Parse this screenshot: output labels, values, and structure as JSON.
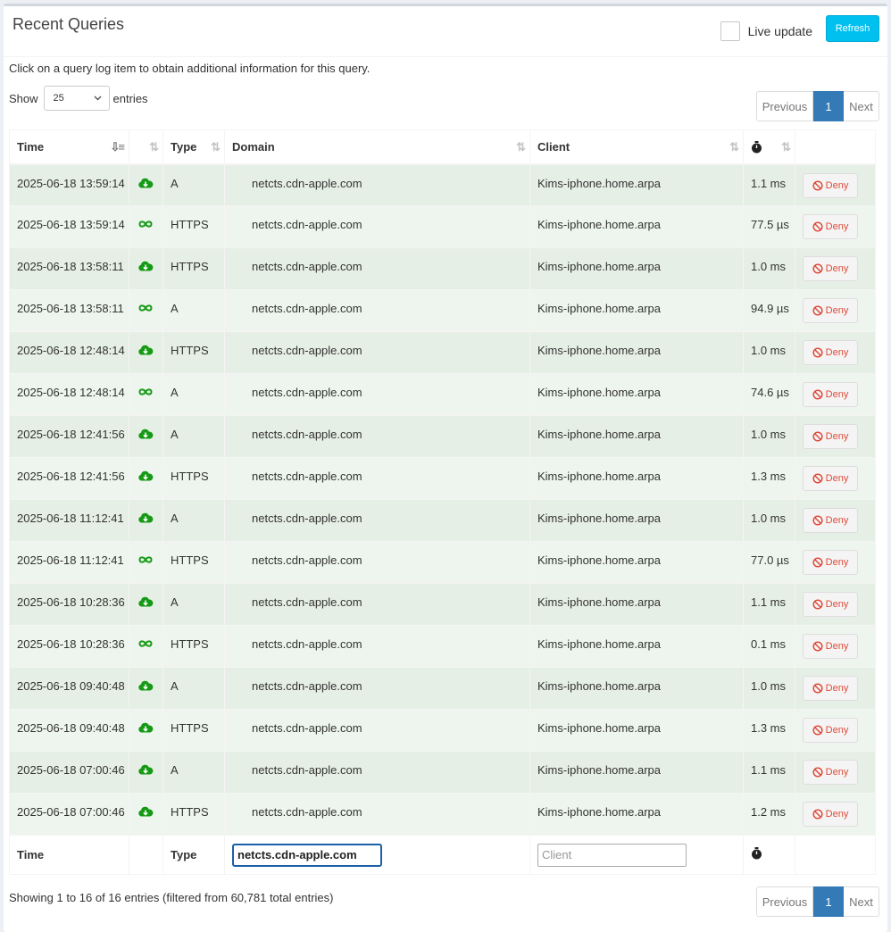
{
  "header": {
    "title": "Recent Queries",
    "live_update_label": "Live update",
    "refresh_label": "Refresh"
  },
  "hint": "Click on a query log item to obtain additional information for this query.",
  "length_control": {
    "show_label": "Show",
    "value": "25",
    "entries_label": "entries"
  },
  "pagination": {
    "previous": "Previous",
    "current": "1",
    "next": "Next"
  },
  "columns": {
    "time": "Time",
    "type": "Type",
    "domain": "Domain",
    "client": "Client"
  },
  "rows": [
    {
      "time": "2025-06-18 13:59:14",
      "status": "forwarded",
      "type": "A",
      "domain": "netcts.cdn-apple.com",
      "client": "Kims-iphone.home.arpa",
      "reply_time": "1.1 ms",
      "action": "Deny"
    },
    {
      "time": "2025-06-18 13:59:14",
      "status": "cached",
      "type": "HTTPS",
      "domain": "netcts.cdn-apple.com",
      "client": "Kims-iphone.home.arpa",
      "reply_time": "77.5 µs",
      "action": "Deny"
    },
    {
      "time": "2025-06-18 13:58:11",
      "status": "forwarded",
      "type": "HTTPS",
      "domain": "netcts.cdn-apple.com",
      "client": "Kims-iphone.home.arpa",
      "reply_time": "1.0 ms",
      "action": "Deny"
    },
    {
      "time": "2025-06-18 13:58:11",
      "status": "cached",
      "type": "A",
      "domain": "netcts.cdn-apple.com",
      "client": "Kims-iphone.home.arpa",
      "reply_time": "94.9 µs",
      "action": "Deny"
    },
    {
      "time": "2025-06-18 12:48:14",
      "status": "forwarded",
      "type": "HTTPS",
      "domain": "netcts.cdn-apple.com",
      "client": "Kims-iphone.home.arpa",
      "reply_time": "1.0 ms",
      "action": "Deny"
    },
    {
      "time": "2025-06-18 12:48:14",
      "status": "cached",
      "type": "A",
      "domain": "netcts.cdn-apple.com",
      "client": "Kims-iphone.home.arpa",
      "reply_time": "74.6 µs",
      "action": "Deny"
    },
    {
      "time": "2025-06-18 12:41:56",
      "status": "forwarded",
      "type": "A",
      "domain": "netcts.cdn-apple.com",
      "client": "Kims-iphone.home.arpa",
      "reply_time": "1.0 ms",
      "action": "Deny"
    },
    {
      "time": "2025-06-18 12:41:56",
      "status": "forwarded",
      "type": "HTTPS",
      "domain": "netcts.cdn-apple.com",
      "client": "Kims-iphone.home.arpa",
      "reply_time": "1.3 ms",
      "action": "Deny"
    },
    {
      "time": "2025-06-18 11:12:41",
      "status": "forwarded",
      "type": "A",
      "domain": "netcts.cdn-apple.com",
      "client": "Kims-iphone.home.arpa",
      "reply_time": "1.0 ms",
      "action": "Deny"
    },
    {
      "time": "2025-06-18 11:12:41",
      "status": "cached",
      "type": "HTTPS",
      "domain": "netcts.cdn-apple.com",
      "client": "Kims-iphone.home.arpa",
      "reply_time": "77.0 µs",
      "action": "Deny"
    },
    {
      "time": "2025-06-18 10:28:36",
      "status": "forwarded",
      "type": "A",
      "domain": "netcts.cdn-apple.com",
      "client": "Kims-iphone.home.arpa",
      "reply_time": "1.1 ms",
      "action": "Deny"
    },
    {
      "time": "2025-06-18 10:28:36",
      "status": "cached",
      "type": "HTTPS",
      "domain": "netcts.cdn-apple.com",
      "client": "Kims-iphone.home.arpa",
      "reply_time": "0.1 ms",
      "action": "Deny"
    },
    {
      "time": "2025-06-18 09:40:48",
      "status": "forwarded",
      "type": "A",
      "domain": "netcts.cdn-apple.com",
      "client": "Kims-iphone.home.arpa",
      "reply_time": "1.0 ms",
      "action": "Deny"
    },
    {
      "time": "2025-06-18 09:40:48",
      "status": "forwarded",
      "type": "HTTPS",
      "domain": "netcts.cdn-apple.com",
      "client": "Kims-iphone.home.arpa",
      "reply_time": "1.3 ms",
      "action": "Deny"
    },
    {
      "time": "2025-06-18 07:00:46",
      "status": "forwarded",
      "type": "A",
      "domain": "netcts.cdn-apple.com",
      "client": "Kims-iphone.home.arpa",
      "reply_time": "1.1 ms",
      "action": "Deny"
    },
    {
      "time": "2025-06-18 07:00:46",
      "status": "forwarded",
      "type": "HTTPS",
      "domain": "netcts.cdn-apple.com",
      "client": "Kims-iphone.home.arpa",
      "reply_time": "1.2 ms",
      "action": "Deny"
    }
  ],
  "filters": {
    "time_label": "Time",
    "type_label": "Type",
    "domain_value": "netcts.cdn-apple.com",
    "client_placeholder": "Client"
  },
  "footer": {
    "showing_text": "Showing 1 to 16 of 16 entries (filtered from 60,781 total entries)"
  },
  "colors": {
    "accent": "#00c0ef",
    "page_active": "#337ab7",
    "status_green": "#169a16",
    "deny_red": "#dd4b39"
  }
}
